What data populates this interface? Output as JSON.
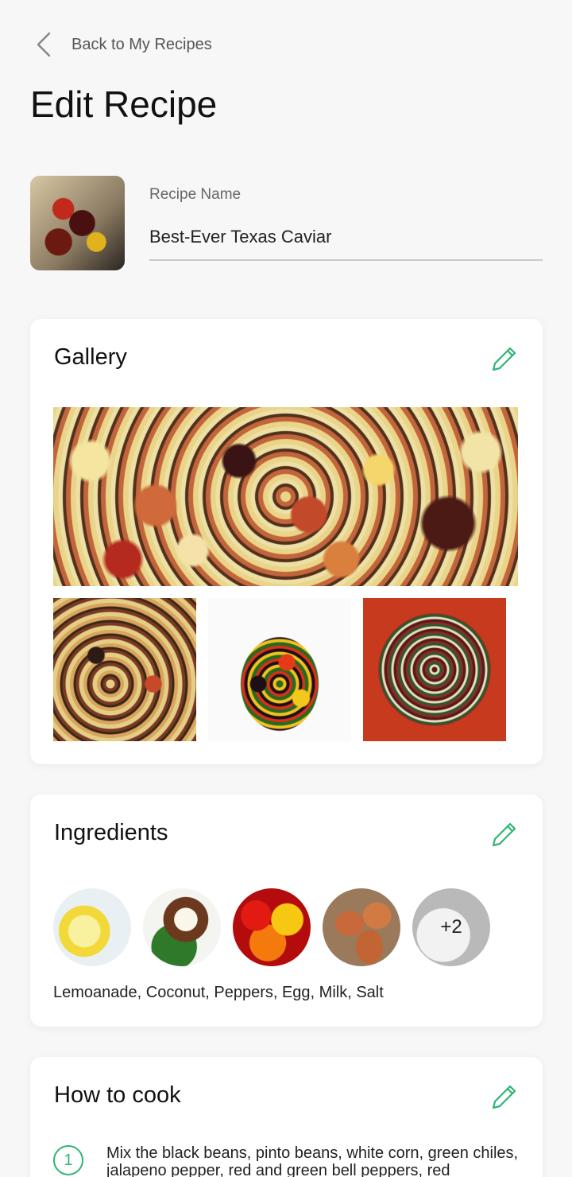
{
  "nav": {
    "back_label": "Back to My Recipes"
  },
  "page": {
    "title": "Edit Recipe"
  },
  "recipe": {
    "name_label": "Recipe Name",
    "name_value": "Best-Ever Texas Caviar"
  },
  "gallery": {
    "title": "Gallery"
  },
  "ingredients": {
    "title": "Ingredients",
    "items": [
      "Lemoanade",
      "Coconut",
      "Peppers",
      "Egg"
    ],
    "more_count": "+2",
    "summary": "Lemoanade, Coconut, Peppers, Egg, Milk, Salt"
  },
  "how_to_cook": {
    "title": "How to cook",
    "steps": [
      {
        "number": "1",
        "text": "Mix the black beans, pinto beans, white corn, green chiles, jalapeno pepper, red and green bell peppers, red"
      }
    ]
  },
  "colors": {
    "accent": "#2bb673",
    "background": "#f7f7f8",
    "card": "#ffffff"
  },
  "icons": {
    "back": "chevron-left-icon",
    "edit": "pencil-icon"
  }
}
